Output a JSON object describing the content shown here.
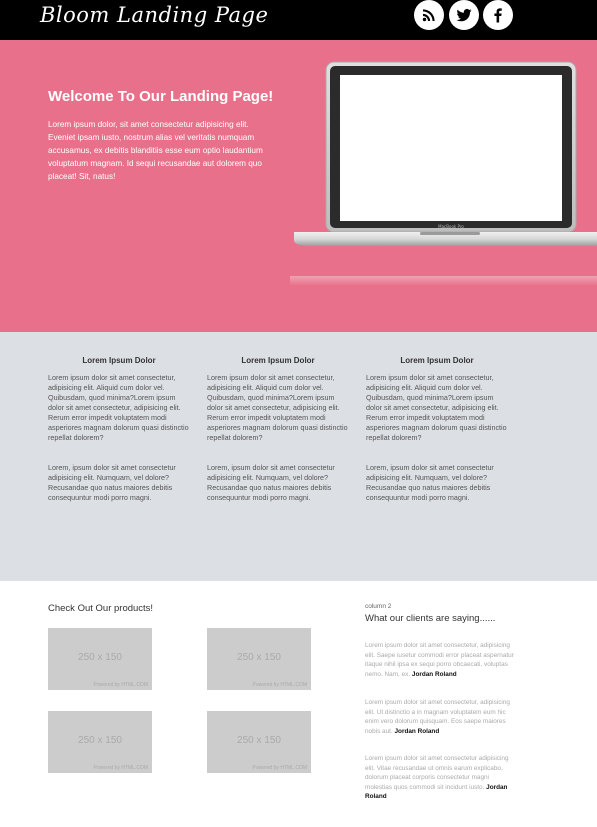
{
  "header": {
    "logo_text": "Bloom Landing Page",
    "social": [
      {
        "icon": "rss-icon"
      },
      {
        "icon": "twitter-icon"
      },
      {
        "icon": "facebook-icon"
      }
    ]
  },
  "hero": {
    "title": "Welcome To Our Landing Page!",
    "text": "Lorem ipsum dolor, sit amet consectetur adipisicing elit. Eveniet ipsam iusto, nostrum alias vel veritatis numquam accusamus, ex debitis blanditiis esse eum optio laudantium voluptatum magnam. Id sequi recusandae aut dolorem quo placeat! Sit, natus!",
    "image": "laptop-image",
    "laptop_label": "MacBook Pro"
  },
  "features": [
    {
      "title": "Lorem Ipsum Dolor",
      "p1": "Lorem ipsum dolor sit amet consectetur, adipisicing elit. Aliquid cum dolor vel. Quibusdam, quod minima?Lorem ipsum dolor sit amet consectetur, adipisicing elit. Rerum error impedit voluptatem modi asperiores magnam dolorum quasi distinctio repellat dolorem?",
      "p2": "Lorem, ipsum dolor sit amet consectetur adipisicing elit. Numquam, vel dolore? Recusandae quo natus maiores debitis consequuntur modi porro magni."
    },
    {
      "title": "Lorem Ipsum Dolor",
      "p1": "Lorem ipsum dolor sit amet consectetur, adipisicing elit. Aliquid cum dolor vel. Quibusdam, quod minima?Lorem ipsum dolor sit amet consectetur, adipisicing elit. Rerum error impedit voluptatem modi asperiores magnam dolorum quasi distinctio repellat dolorem?",
      "p2": "Lorem, ipsum dolor sit amet consectetur adipisicing elit. Numquam, vel dolore? Recusandae quo natus maiores debitis consequuntur modi porro magni."
    },
    {
      "title": "Lorem Ipsum Dolor",
      "p1": "Lorem ipsum dolor sit amet consectetur, adipisicing elit. Aliquid cum dolor vel. Quibusdam, quod minima?Lorem ipsum dolor sit amet consectetur, adipisicing elit. Rerum error impedit voluptatem modi asperiores magnam dolorum quasi distinctio repellat dolorem?",
      "p2": "Lorem, ipsum dolor sit amet consectetur adipisicing elit. Numquam, vel dolore? Recusandae quo natus maiores debitis consequuntur modi porro magni."
    }
  ],
  "products": {
    "title": "Check Out Our products!",
    "items": [
      {
        "label": "250 x 150",
        "powered": "Powered by HTML.COM"
      },
      {
        "label": "250 x 150",
        "powered": "Powered by HTML.COM"
      },
      {
        "label": "250 x 150",
        "powered": "Powered by HTML.COM"
      },
      {
        "label": "250 x 150",
        "powered": "Powered by HTML.COM"
      }
    ]
  },
  "clients": {
    "column_label": "column 2",
    "title": "What our clients are saying......",
    "testimonials": [
      {
        "text": "Lorem ipsum dolor sit amet consectetur, adipisicing elit. Saepe iusetur commodi error placeat aspernatur itaque nihil ipsa ex sequi porro obcaecati, voluptas nemo. Nam, ex.",
        "author": "Jordan Roland"
      },
      {
        "text": "Lorem ipsum dolor sit amet consectetur, adipisicing elit. Ut distinctio a in magnam voluptatem eum hic enim vero dolorum quisquam. Eos saepe maiores nobis aut.",
        "author": "Jordan Roland"
      },
      {
        "text": "Lorem ipsum dolor sit amet consectetur adipisicing elit. Vitae recusandae ut omnis earum explicabo, dolorum placeat corporis consectetur magni molestias quos commodi sit incidunt iusto.",
        "author": "Jordan Roland"
      }
    ]
  }
}
